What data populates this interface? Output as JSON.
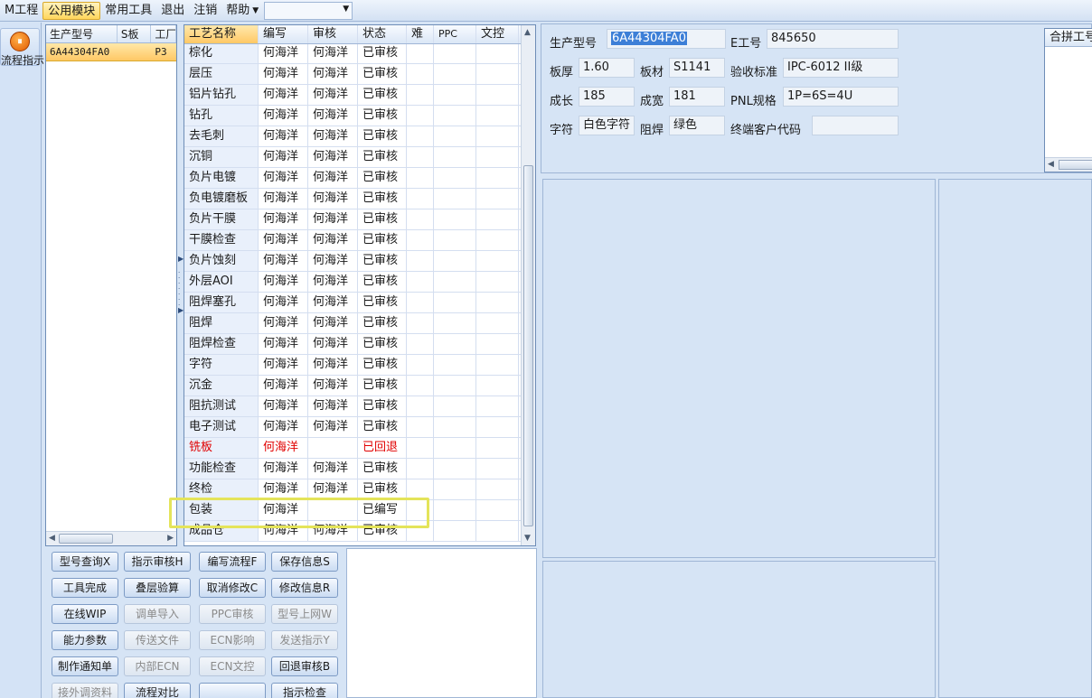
{
  "menubar": {
    "items": [
      "M工程",
      "公用模块",
      "常用工具",
      "退出",
      "注销",
      "帮助"
    ],
    "combo_value": ""
  },
  "leftstrip": {
    "icon": "process-guide-icon",
    "label": "流程指示"
  },
  "model_list": {
    "columns": [
      "生产型号",
      "S板",
      "工厂"
    ],
    "rows": [
      [
        "6A44304FA0",
        "",
        "P3"
      ]
    ]
  },
  "process_grid": {
    "columns": [
      "工艺名称",
      "编写",
      "审核",
      "状态",
      "难",
      "PPC",
      "文控"
    ],
    "rows": [
      {
        "name": "棕化",
        "writer": "何海洋",
        "reviewer": "何海洋",
        "status": "已审核"
      },
      {
        "name": "层压",
        "writer": "何海洋",
        "reviewer": "何海洋",
        "status": "已审核"
      },
      {
        "name": "铝片钻孔",
        "writer": "何海洋",
        "reviewer": "何海洋",
        "status": "已审核"
      },
      {
        "name": "钻孔",
        "writer": "何海洋",
        "reviewer": "何海洋",
        "status": "已审核"
      },
      {
        "name": "去毛刺",
        "writer": "何海洋",
        "reviewer": "何海洋",
        "status": "已审核"
      },
      {
        "name": "沉铜",
        "writer": "何海洋",
        "reviewer": "何海洋",
        "status": "已审核"
      },
      {
        "name": "负片电镀",
        "writer": "何海洋",
        "reviewer": "何海洋",
        "status": "已审核"
      },
      {
        "name": "负电镀磨板",
        "writer": "何海洋",
        "reviewer": "何海洋",
        "status": "已审核"
      },
      {
        "name": "负片干膜",
        "writer": "何海洋",
        "reviewer": "何海洋",
        "status": "已审核"
      },
      {
        "name": "干膜检查",
        "writer": "何海洋",
        "reviewer": "何海洋",
        "status": "已审核"
      },
      {
        "name": "负片蚀刻",
        "writer": "何海洋",
        "reviewer": "何海洋",
        "status": "已审核"
      },
      {
        "name": "外层AOI",
        "writer": "何海洋",
        "reviewer": "何海洋",
        "status": "已审核"
      },
      {
        "name": "阻焊塞孔",
        "writer": "何海洋",
        "reviewer": "何海洋",
        "status": "已审核"
      },
      {
        "name": "阻焊",
        "writer": "何海洋",
        "reviewer": "何海洋",
        "status": "已审核"
      },
      {
        "name": "阻焊检查",
        "writer": "何海洋",
        "reviewer": "何海洋",
        "status": "已审核"
      },
      {
        "name": "字符",
        "writer": "何海洋",
        "reviewer": "何海洋",
        "status": "已审核"
      },
      {
        "name": "沉金",
        "writer": "何海洋",
        "reviewer": "何海洋",
        "status": "已审核"
      },
      {
        "name": "阻抗测试",
        "writer": "何海洋",
        "reviewer": "何海洋",
        "status": "已审核"
      },
      {
        "name": "电子测试",
        "writer": "何海洋",
        "reviewer": "何海洋",
        "status": "已审核"
      },
      {
        "name": "铣板",
        "writer": "何海洋",
        "reviewer": "",
        "status": "已回退",
        "alert": true
      },
      {
        "name": "功能检查",
        "writer": "何海洋",
        "reviewer": "何海洋",
        "status": "已审核"
      },
      {
        "name": "终检",
        "writer": "何海洋",
        "reviewer": "何海洋",
        "status": "已审核"
      },
      {
        "name": "包装",
        "writer": "何海洋",
        "reviewer": "",
        "status": "已编写"
      },
      {
        "name": "成品仓",
        "writer": "何海洋",
        "reviewer": "何海洋",
        "status": "已审核"
      }
    ],
    "alert_color": "#e00000"
  },
  "buttons": [
    {
      "label": "型号查询X",
      "enabled": true
    },
    {
      "label": "指示审核H",
      "enabled": true
    },
    {
      "label": "编写流程F",
      "enabled": true
    },
    {
      "label": "保存信息S",
      "enabled": true
    },
    {
      "label": "工具完成",
      "enabled": true
    },
    {
      "label": "叠层验算",
      "enabled": true
    },
    {
      "label": "取消修改C",
      "enabled": true
    },
    {
      "label": "修改信息R",
      "enabled": true
    },
    {
      "label": "在线WIP",
      "enabled": true
    },
    {
      "label": "调单导入",
      "enabled": false
    },
    {
      "label": "PPC审核",
      "enabled": false
    },
    {
      "label": "型号上网W",
      "enabled": false
    },
    {
      "label": "能力参数",
      "enabled": true
    },
    {
      "label": "传送文件",
      "enabled": false
    },
    {
      "label": "ECN影响",
      "enabled": false
    },
    {
      "label": "发送指示Y",
      "enabled": false
    },
    {
      "label": "制作通知单",
      "enabled": true
    },
    {
      "label": "内部ECN",
      "enabled": false
    },
    {
      "label": "ECN文控",
      "enabled": false
    },
    {
      "label": "回退审核B",
      "enabled": true
    },
    {
      "label": "接外调资料",
      "enabled": false
    },
    {
      "label": "流程对比",
      "enabled": true
    },
    {
      "label": "",
      "enabled": true
    },
    {
      "label": "指示检查",
      "enabled": true
    }
  ],
  "info": {
    "model_label": "生产型号",
    "model_value": "6A44304FA0",
    "e_label": "E工号",
    "e_value": "845650",
    "thickness_label": "板厚",
    "thickness_value": "1.60",
    "material_label": "板材",
    "material_value": "S1141",
    "standard_label": "验收标准",
    "standard_value": "IPC-6012 II级",
    "length_label": "成长",
    "length_value": "185",
    "width_label": "成宽",
    "width_value": "181",
    "pnl_label": "PNL规格",
    "pnl_value": "1P=6S=4U",
    "char_label": "字符",
    "char_value": "白色字符",
    "mask_label": "阻焊",
    "mask_value": "绿色",
    "customer_label": "终端客户代码",
    "customer_value": "",
    "combine_header": "合拼工号"
  },
  "selection_color": "#3d7fd7",
  "highlight_color": "#e4e45a"
}
